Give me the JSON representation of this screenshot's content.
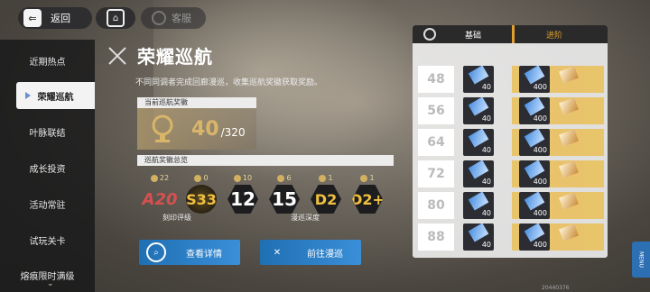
{
  "header": {
    "back_label": "返回",
    "service_label": "客服"
  },
  "sidebar": {
    "items": [
      {
        "label": "近期热点"
      },
      {
        "label": "荣耀巡航",
        "active": true
      },
      {
        "label": "叶脉联结"
      },
      {
        "label": "成长投资"
      },
      {
        "label": "活动常驻"
      },
      {
        "label": "试玩关卡"
      },
      {
        "label": "熔痕限时满级"
      }
    ]
  },
  "main": {
    "title": "荣耀巡航",
    "subtitle": "不同同调者完成回廊漫巡，收集巡航奖徽获取奖励。",
    "total_label": "当前巡航奖徽",
    "total_current": "40",
    "total_max": "/320",
    "overview_label": "巡航奖徽总览",
    "badges": [
      {
        "count": "22",
        "mark": "A20",
        "style": "red"
      },
      {
        "count": "0",
        "mark": "S33",
        "style": "s"
      },
      {
        "count": "10",
        "mark": "12",
        "style": "dark"
      },
      {
        "count": "6",
        "mark": "15",
        "style": "dark"
      },
      {
        "count": "1",
        "mark": "D2",
        "style": "gold"
      },
      {
        "count": "1",
        "mark": "D2+",
        "style": "gold"
      }
    ],
    "caption_left": "刻印评级",
    "caption_right": "漫巡深度",
    "detail_button": "查看详情",
    "go_button": "前往漫巡"
  },
  "panel": {
    "tab_basic": "基础",
    "tab_advanced": "进阶",
    "rows": [
      {
        "level": "48",
        "base_qty": "40",
        "adv_qty": "400"
      },
      {
        "level": "56",
        "base_qty": "40",
        "adv_qty": "400"
      },
      {
        "level": "64",
        "base_qty": "40",
        "adv_qty": "400"
      },
      {
        "level": "72",
        "base_qty": "40",
        "adv_qty": "400"
      },
      {
        "level": "80",
        "base_qty": "40",
        "adv_qty": "400"
      },
      {
        "level": "88",
        "base_qty": "40",
        "adv_qty": "400"
      }
    ]
  },
  "menu_label": "MENU",
  "uid": "20440376"
}
